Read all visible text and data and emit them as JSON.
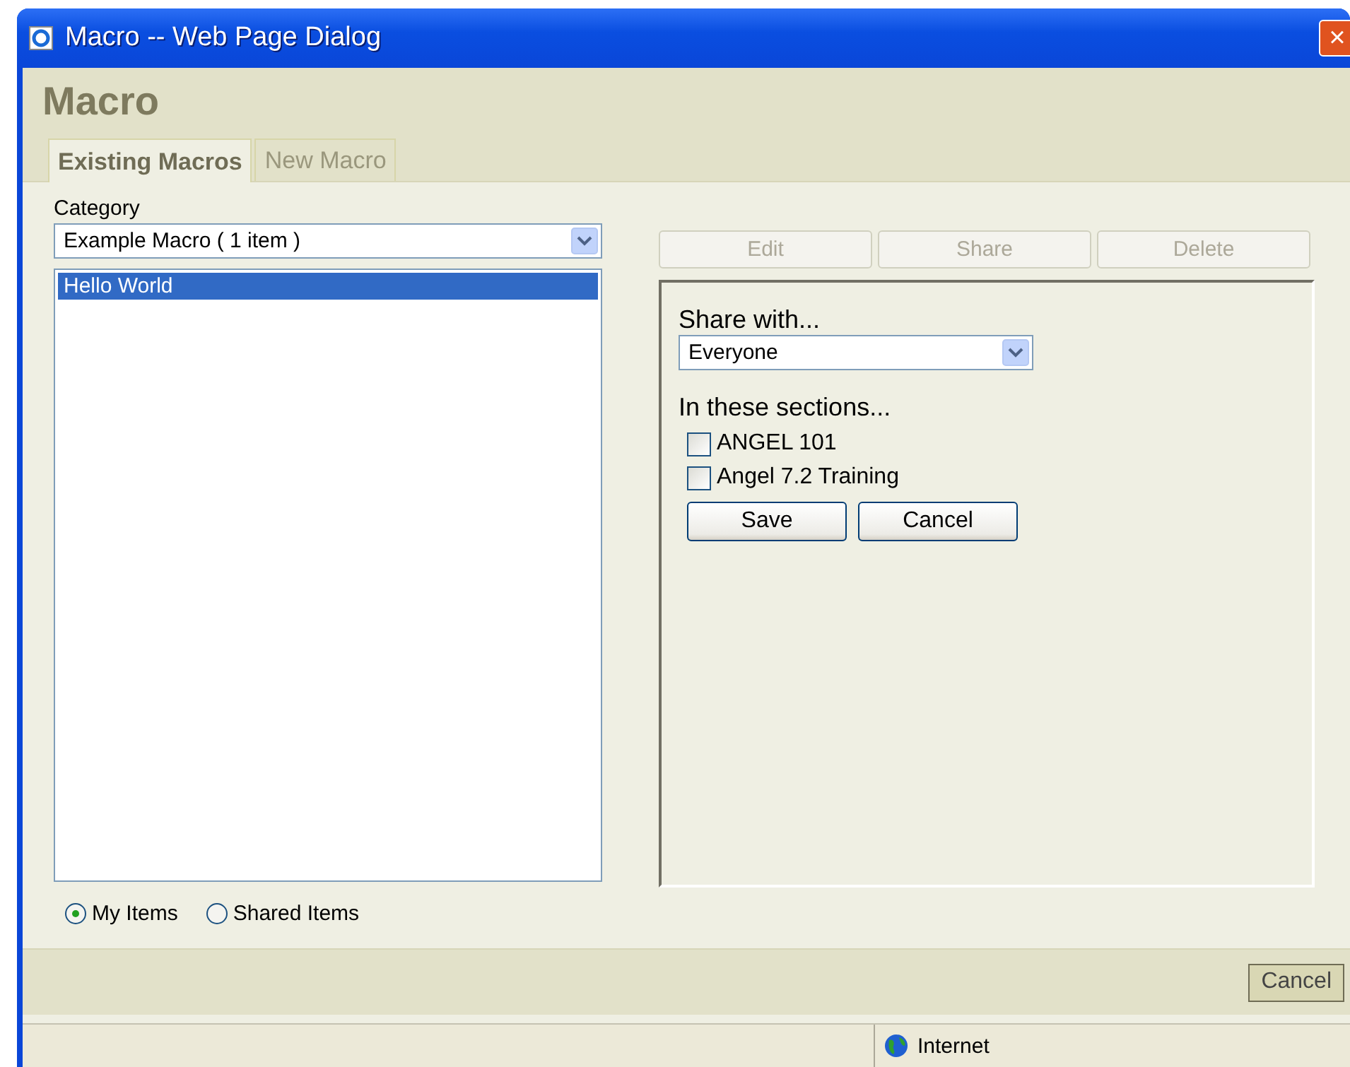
{
  "window": {
    "title": "Macro -- Web Page Dialog",
    "close": "×"
  },
  "heading": "Macro",
  "tabs": [
    {
      "label": "Existing Macros",
      "selected": true
    },
    {
      "label": "New Macro",
      "selected": false
    }
  ],
  "category": {
    "label": "Category",
    "value": "Example Macro  ( 1 item )"
  },
  "macros": [
    {
      "label": "Hello World",
      "selected": true
    }
  ],
  "filters": [
    {
      "label": "My Items",
      "selected": true
    },
    {
      "label": "Shared Items",
      "selected": false
    }
  ],
  "actions": [
    {
      "label": "Edit",
      "disabled": true
    },
    {
      "label": "Share",
      "disabled": true
    },
    {
      "label": "Delete",
      "disabled": true
    }
  ],
  "share": {
    "label": "Share with...",
    "value": "Everyone",
    "sections_label": "In these sections...",
    "sections": [
      {
        "label": "ANGEL 101",
        "checked": false
      },
      {
        "label": "Angel 7.2 Training",
        "checked": false
      }
    ],
    "buttons": [
      "Save",
      "Cancel"
    ]
  },
  "footer_button": "Cancel",
  "status_bar": {
    "zone": "Internet"
  }
}
